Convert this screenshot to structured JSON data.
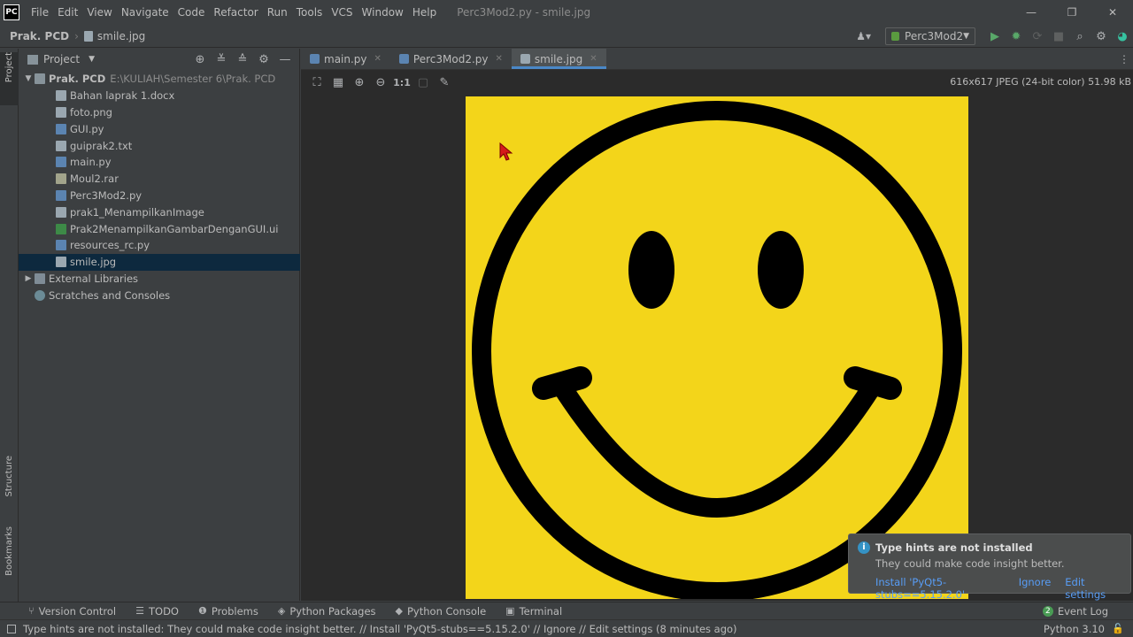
{
  "menu": [
    "File",
    "Edit",
    "View",
    "Navigate",
    "Code",
    "Refactor",
    "Run",
    "Tools",
    "VCS",
    "Window",
    "Help"
  ],
  "app_logo": "PC",
  "window_title": "Perc3Mod2.py - smile.jpg",
  "window_controls": {
    "minimize": "—",
    "restore": "❐",
    "close": "✕"
  },
  "breadcrumb": {
    "project": "Prak. PCD",
    "file": "smile.jpg"
  },
  "run_config": "Perc3Mod2",
  "left_strip": {
    "project": "Project",
    "structure": "Structure",
    "bookmarks": "Bookmarks"
  },
  "project_panel": {
    "title": "Project",
    "root": {
      "name": "Prak. PCD",
      "path": "E:\\KULIAH\\Semester 6\\Prak. PCD"
    },
    "files": [
      {
        "name": "Bahan laprak 1.docx",
        "kind": "file"
      },
      {
        "name": "foto.png",
        "kind": "file"
      },
      {
        "name": "GUI.py",
        "kind": "py"
      },
      {
        "name": "guiprak2.txt",
        "kind": "file"
      },
      {
        "name": "main.py",
        "kind": "py"
      },
      {
        "name": "Moul2.rar",
        "kind": "rar"
      },
      {
        "name": "Perc3Mod2.py",
        "kind": "py"
      },
      {
        "name": "prak1_MenampilkanImage",
        "kind": "file"
      },
      {
        "name": "Prak2MenampilkanGambarDenganGUI.ui",
        "kind": "ui"
      },
      {
        "name": "resources_rc.py",
        "kind": "py"
      },
      {
        "name": "smile.jpg",
        "kind": "file",
        "selected": true
      }
    ],
    "external_libraries": "External Libraries",
    "scratches": "Scratches and Consoles"
  },
  "tabs": [
    {
      "label": "main.py",
      "kind": "py",
      "active": false
    },
    {
      "label": "Perc3Mod2.py",
      "kind": "py",
      "active": false
    },
    {
      "label": "smile.jpg",
      "kind": "img",
      "active": true
    }
  ],
  "image_toolbar": {
    "actual_size": "1:1"
  },
  "image_info": "616x617 JPEG (24-bit color) 51.98 kB",
  "notification": {
    "title": "Type hints are not installed",
    "body": "They could make code insight better.",
    "actions": [
      "Install 'PyQt5-stubs==5.15.2.0'",
      "Ignore",
      "Edit settings"
    ]
  },
  "bottom_tools": [
    "Version Control",
    "TODO",
    "Problems",
    "Python Packages",
    "Python Console",
    "Terminal"
  ],
  "event_log": {
    "count": "2",
    "label": "Event Log"
  },
  "status": {
    "message": "Type hints are not installed: They could make code insight better. // Install 'PyQt5-stubs==5.15.2.0' // Ignore // Edit settings (8 minutes ago)",
    "interpreter": "Python 3.10"
  },
  "colors": {
    "accent": "#4a88c7",
    "image_bg": "#f3d51a",
    "selection": "#0d293e"
  }
}
